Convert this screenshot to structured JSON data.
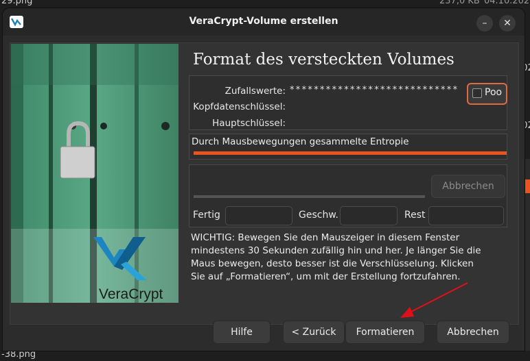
{
  "background": {
    "filename_top": "29.png",
    "filename_bottom": "-38.png",
    "size_text": "237,0 KB",
    "date_text": "04.10.202",
    "date_text2": "202",
    "col_fragment": "e"
  },
  "window": {
    "title": "VeraCrypt-Volume erstellen",
    "minimize_glyph": "–",
    "close_glyph": "✕"
  },
  "panel_image": {
    "brand": "VeraCrypt"
  },
  "main": {
    "heading": "Format des versteckten Volumes",
    "random_label": "Zufallswerte:",
    "random_value": "****************************",
    "header_key_label": "Kopfdatenschlüssel:",
    "master_key_label": "Hauptschlüssel:",
    "pool_label": "Poo",
    "entropy_label": "Durch Mausbewegungen gesammelte Entropie",
    "entropy_fraction": 1.0,
    "abort_inner_label": "Abbrechen",
    "done_label": "Fertig",
    "speed_label": "Geschw.",
    "remaining_label": "Rest",
    "warning": "WICHTIG: Bewegen Sie den Mauszeiger in diesem Fenster mindestens 30 Sekunden zufällig hin und her. Je länger Sie die Maus bewegen, desto besser ist die Verschlüsselung. Klicken Sie auf „Formatieren“, um mit der Erstellung fortzufahren."
  },
  "footer": {
    "help_label": "Hilfe",
    "back_label": "< Zurück",
    "format_label": "Formatieren",
    "cancel_label": "Abbrechen"
  },
  "colors": {
    "accent": "#e95420",
    "annotation_arrow": "#e0101a"
  }
}
